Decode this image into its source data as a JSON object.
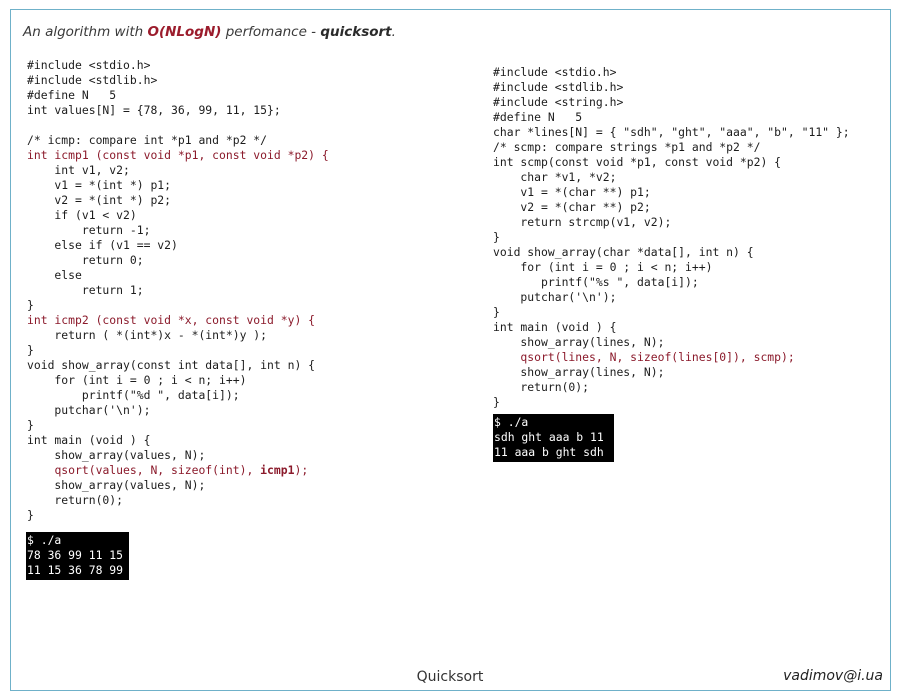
{
  "slide": {
    "title_prefix": "An algorithm with ",
    "title_complexity": "O(NLogN)",
    "title_middle": " perfomance - ",
    "title_algorithm": "quicksort",
    "title_suffix": ".",
    "footer_title": "Quicksort",
    "footer_author": "vadimov@i.ua"
  },
  "left_code": {
    "lines": [
      "#include <stdio.h>",
      "#include <stdlib.h>",
      "#define N   5",
      "int values[N] = {78, 36, 99, 11, 15};",
      "",
      "/* icmp: compare int *p1 and *p2 */",
      "int icmp1 (const void *p1, const void *p2) {",
      "    int v1, v2;",
      "    v1 = *(int *) p1;",
      "    v2 = *(int *) p2;",
      "    if (v1 < v2)",
      "        return -1;",
      "    else if (v1 == v2)",
      "        return 0;",
      "    else",
      "        return 1;",
      "}",
      "int icmp2 (const void *x, const void *y) {",
      "    return ( *(int*)x - *(int*)y );",
      "}",
      "void show_array(const int data[], int n) {",
      "    for (int i = 0 ; i < n; i++)",
      "        printf(\"%d \", data[i]);",
      "    putchar('\\n');",
      "}",
      "int main (void ) {",
      "    show_array(values, N);",
      "    show_array(values, N);",
      "    return(0);",
      "}"
    ],
    "qsort_call": "qsort(values, N, sizeof(int), ",
    "qsort_cmp": "icmp1",
    "qsort_end": ");"
  },
  "left_output": {
    "lines": [
      "$ ./a",
      "78 36 99 11 15",
      "11 15 36 78 99"
    ]
  },
  "right_code": {
    "lines": [
      "#include <stdio.h>",
      "#include <stdlib.h>",
      "#include <string.h>",
      "#define N   5",
      "char *lines[N] = { \"sdh\", \"ght\", \"aaa\", \"b\", \"11\" };",
      "/* scmp: compare strings *p1 and *p2 */",
      "int scmp(const void *p1, const void *p2) {",
      "    char *v1, *v2;",
      "    v1 = *(char **) p1;",
      "    v2 = *(char **) p2;",
      "    return strcmp(v1, v2);",
      "}",
      "void show_array(char *data[], int n) {",
      "    for (int i = 0 ; i < n; i++)",
      "       printf(\"%s \", data[i]);",
      "    putchar('\\n');",
      "}",
      "int main (void ) {",
      "    show_array(lines, N);",
      "    qsort(lines, N, sizeof(lines[0]), scmp);",
      "    show_array(lines, N);",
      "    return(0);",
      "}"
    ]
  },
  "right_output": {
    "lines": [
      "$ ./a",
      "sdh ght aaa b 11",
      "11 aaa b ght sdh"
    ]
  }
}
